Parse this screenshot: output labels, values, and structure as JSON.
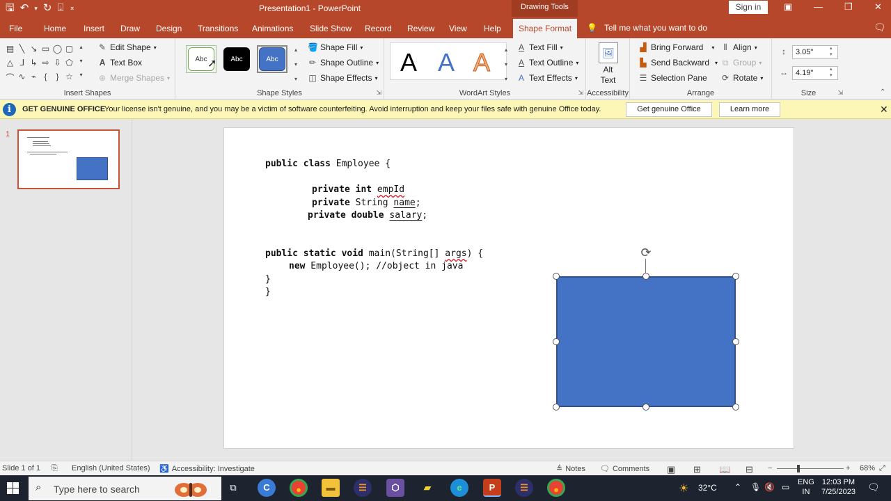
{
  "titlebar": {
    "title": "Presentation1  -  PowerPoint",
    "context_group": "Drawing Tools",
    "sign_in": "Sign in"
  },
  "tabs": [
    "File",
    "Home",
    "Insert",
    "Draw",
    "Design",
    "Transitions",
    "Animations",
    "Slide Show",
    "Record",
    "Review",
    "View",
    "Help",
    "Shape Format"
  ],
  "tell_me": "Tell me what you want to do",
  "ribbon": {
    "insert_shapes": {
      "label": "Insert Shapes",
      "edit_shape": "Edit Shape",
      "text_box": "Text Box",
      "merge_shapes": "Merge Shapes"
    },
    "shape_styles": {
      "label": "Shape Styles",
      "presets": [
        "Abc",
        "Abc",
        "Abc"
      ],
      "shape_fill": "Shape Fill",
      "shape_outline": "Shape Outline",
      "shape_effects": "Shape Effects"
    },
    "wordart_styles": {
      "label": "WordArt Styles",
      "letters": [
        "A",
        "A",
        "A"
      ],
      "text_fill": "Text Fill",
      "text_outline": "Text Outline",
      "text_effects": "Text Effects"
    },
    "accessibility": {
      "label": "Accessibility",
      "alt_text_line1": "Alt",
      "alt_text_line2": "Text"
    },
    "arrange": {
      "label": "Arrange",
      "bring_forward": "Bring Forward",
      "send_backward": "Send Backward",
      "selection_pane": "Selection Pane",
      "align": "Align",
      "group": "Group",
      "rotate": "Rotate"
    },
    "size": {
      "label": "Size",
      "height": "3.05\"",
      "width": "4.19\""
    }
  },
  "message_bar": {
    "title": "GET GENUINE OFFICE",
    "text": "Your license isn't genuine, and you may be a victim of software counterfeiting. Avoid interruption and keep your files safe with genuine Office today.",
    "get_genuine": "Get genuine Office",
    "learn_more": "Learn more"
  },
  "thumbnail": {
    "slide_number": "1"
  },
  "slide_code": {
    "line1_kw": "public class",
    "line1_rest": " Employee {",
    "line2_kw": "private int",
    "line2_var": "empId",
    "line3_kw": "private",
    "line3_type": " String ",
    "line3_var": "name",
    "line3_end": ";",
    "line4_kw": "private double",
    "line4_var": "salary",
    "line4_end": ";",
    "line5_kw": "public static void",
    "line5_a": " main(String[] ",
    "line5_args": "args",
    "line5_b": ") {",
    "line6_kw": "new",
    "line6_rest": " Employee(); //object in java",
    "line7": "}",
    "line8": "}"
  },
  "statusbar": {
    "slide_of": "Slide 1 of 1",
    "language": "English (United States)",
    "accessibility": "Accessibility: Investigate",
    "notes": "Notes",
    "comments": "Comments",
    "zoom": "68%"
  },
  "taskbar": {
    "search_placeholder": "Type here to search",
    "weather": "32°C",
    "lang_line1": "ENG",
    "lang_line2": "IN",
    "time": "12:03 PM",
    "date": "7/25/2023"
  },
  "colors": {
    "ppt_accent": "#b7472a",
    "shape_fill": "#4472c4",
    "shape_outline": "#2f528f",
    "message_bar": "#fcf7b6"
  }
}
